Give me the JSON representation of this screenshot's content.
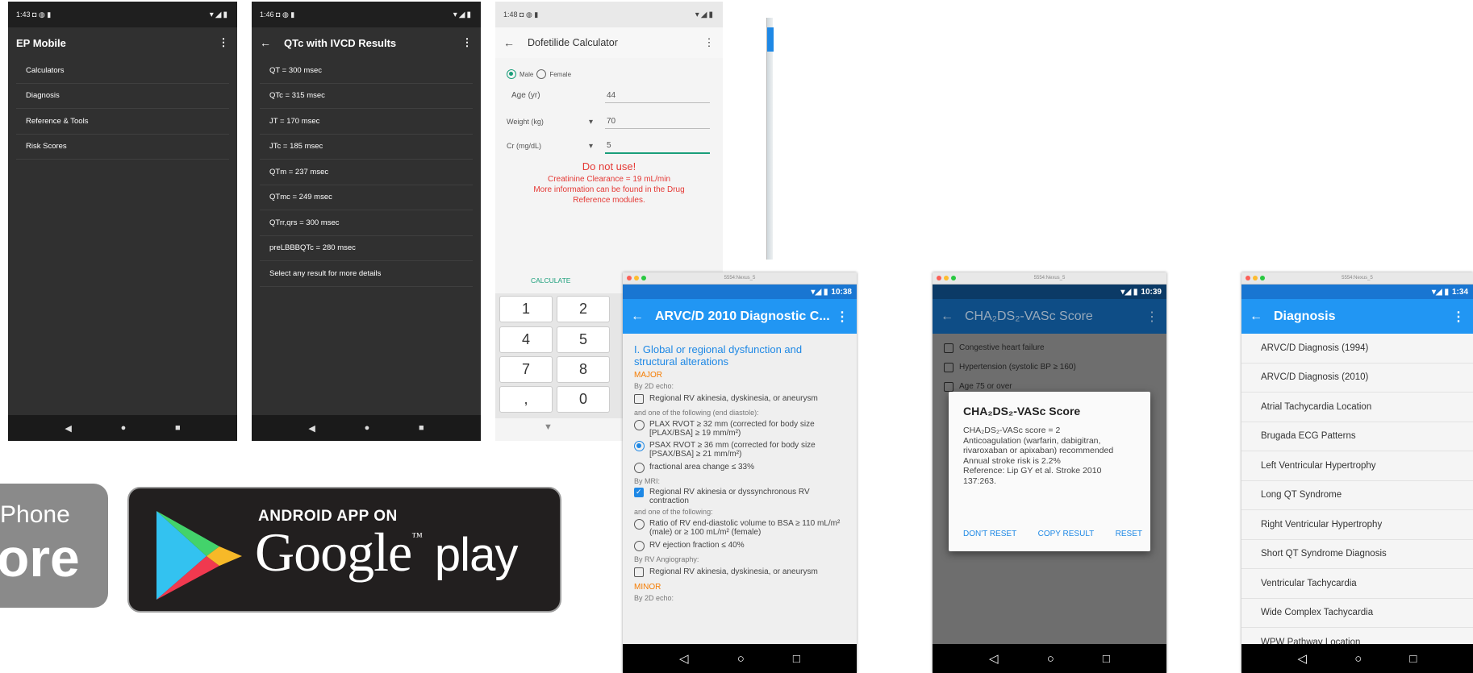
{
  "phone1": {
    "status": {
      "time": "1:43 ◘ ◍ ▮",
      "icons": "▾◢▮"
    },
    "app_title": "EP Mobile",
    "menu_icon": "⋮",
    "items": [
      "Calculators",
      "Diagnosis",
      "Reference & Tools",
      "Risk Scores"
    ],
    "nav": {
      "back": "◀",
      "home": "●",
      "recent": "■"
    }
  },
  "phone2": {
    "status": {
      "time": "1:46 ◘ ◍ ▮",
      "icons": "▾◢▮"
    },
    "back_icon": "←",
    "title": "QTc with IVCD Results",
    "menu_icon": "⋮",
    "items": [
      "QT = 300 msec",
      "QTc = 315 msec",
      "JT = 170 msec",
      "JTc = 185 msec",
      "QTm = 237 msec",
      "QTmc = 249 msec",
      "QTrr,qrs = 300 msec",
      "preLBBBQTc = 280 msec",
      "Select any result for more details"
    ],
    "nav": {
      "back": "◀",
      "home": "●",
      "recent": "■"
    }
  },
  "phone3": {
    "status": {
      "time": "1:48 ◘ ◍ ▮",
      "icons": "▾◢▮"
    },
    "back_icon": "←",
    "title": "Dofetilide Calculator",
    "menu_icon": "⋮",
    "sex_male": "Male",
    "sex_female": "Female",
    "age_label": "Age (yr)",
    "age_value": "44",
    "weight_label": "Weight (kg)",
    "weight_value": "70",
    "cr_label": "Cr (mg/dL)",
    "cr_value": "5",
    "dropdown_icon": "▾",
    "warning_title": "Do not use!",
    "warning_line1": "Creatinine Clearance = 19 mL/min",
    "warning_line2": "More information can be found in the Drug",
    "warning_line3": "Reference modules.",
    "calculate_label": "CALCULATE",
    "keys": [
      "1",
      "2",
      "4",
      "5",
      "7",
      "8",
      ",",
      "0"
    ],
    "collapse_icon": "▼"
  },
  "badges": {
    "iphone_text1": "Phone",
    "iphone_text2": "ore",
    "android_small": "ANDROID APP ON",
    "android_big": "Google",
    "android_tm": "™",
    "android_play": "play"
  },
  "phone4": {
    "window_title": "5554:Nexus_5",
    "status_time": "10:38",
    "status_icons": "▾◢ ▮",
    "back_icon": "←",
    "title": "ARVC/D 2010 Diagnostic C...",
    "menu_icon": "⋮",
    "heading": "I. Global or regional dysfunction and structural alterations",
    "major": "MAJOR",
    "by_2d_echo": "By 2D echo:",
    "opt_regional": "Regional RV akinesia, dyskinesia, or aneurysm",
    "and_one_end_diastole": "and one of the following (end diastole):",
    "opt_plax": "PLAX RVOT ≥ 32 mm (corrected for body size [PLAX/BSA] ≥ 19 mm/m²)",
    "opt_psax": "PSAX RVOT ≥ 36 mm (corrected for body size [PSAX/BSA] ≥ 21 mm/m²)",
    "opt_fac": "fractional area change ≤ 33%",
    "by_mri": "By MRI:",
    "opt_mri_regional": "Regional RV akinesia or dyssynchronous RV contraction",
    "and_one": "and one of the following:",
    "opt_ratio": "Ratio of RV end-diastolic volume to BSA ≥ 110 mL/m² (male) or ≥ 100 mL/m² (female)",
    "opt_ef": "RV ejection fraction ≤ 40%",
    "by_angio": "By RV Angiography:",
    "opt_angio": "Regional RV akinesia, dyskinesia, or aneurysm",
    "minor": "MINOR",
    "by_2d_echo_2": "By 2D echo:",
    "nav": {
      "back": "◁",
      "home": "○",
      "recent": "□"
    }
  },
  "phone5": {
    "window_title": "5554:Nexus_5",
    "status_time": "10:39",
    "status_icons": "▾◢ ▮",
    "back_icon": "←",
    "title": "CHA₂DS₂-VASc Score",
    "menu_icon": "⋮",
    "bg_items": [
      "Congestive heart failure",
      "Hypertension (systolic BP ≥ 160)",
      "Age 75 or over"
    ],
    "dialog_title": "CHA₂DS₂-VASc Score",
    "dialog_body": [
      "CHA₂DS₂-VASc score = 2",
      "Anticoagulation (warfarin, dabigitran, rivaroxaban or apixaban) recommended",
      "Annual stroke risk is 2.2%",
      "Reference: Lip GY et al. Stroke 2010 137:263."
    ],
    "btn_dont_reset": "DON'T RESET",
    "btn_copy": "COPY RESULT",
    "btn_reset": "RESET",
    "nav": {
      "back": "◁",
      "home": "○",
      "recent": "□"
    }
  },
  "phone6": {
    "window_title": "5554:Nexus_5",
    "status_time": "1:34",
    "status_icons": "▾◢ ▮",
    "back_icon": "←",
    "title": "Diagnosis",
    "menu_icon": "⋮",
    "items": [
      "ARVC/D Diagnosis (1994)",
      "ARVC/D Diagnosis (2010)",
      "Atrial Tachycardia Location",
      "Brugada ECG Patterns",
      "Left Ventricular Hypertrophy",
      "Long QT Syndrome",
      "Right Ventricular Hypertrophy",
      "Short QT Syndrome Diagnosis",
      "Ventricular Tachycardia",
      "Wide Complex Tachycardia",
      "WPW Pathway Location"
    ],
    "nav": {
      "back": "◁",
      "home": "○",
      "recent": "□"
    }
  },
  "colors": {
    "blue": "#2196f3",
    "dark_blue": "#1e88e5",
    "orange": "#f57c00",
    "red": "#e53935",
    "teal": "#1a9e7a"
  }
}
